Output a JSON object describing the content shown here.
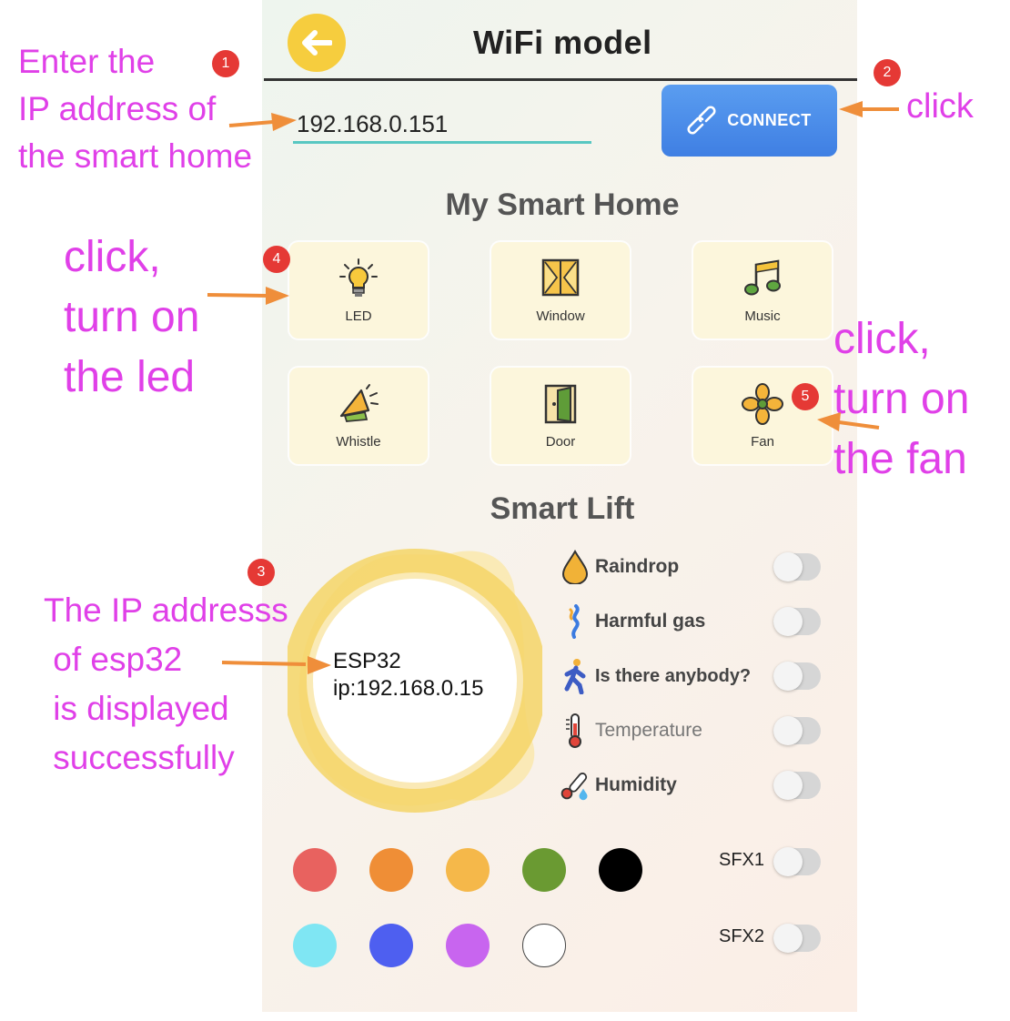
{
  "header": {
    "title": "WiFi model",
    "back_icon": "arrow-left-icon"
  },
  "connection": {
    "ip_value": "192.168.0.151",
    "connect_label": "CONNECT",
    "connect_icon": "link-icon"
  },
  "smart_home": {
    "title": "My Smart Home",
    "tiles": [
      {
        "label": "LED",
        "icon": "bulb-icon"
      },
      {
        "label": "Window",
        "icon": "window-icon"
      },
      {
        "label": "Music",
        "icon": "music-note-icon"
      },
      {
        "label": "Whistle",
        "icon": "whistle-icon"
      },
      {
        "label": "Door",
        "icon": "door-icon"
      },
      {
        "label": "Fan",
        "icon": "fan-icon"
      }
    ]
  },
  "smart_lift": {
    "title": "Smart Lift",
    "device_name": "ESP32",
    "device_ip": "ip:192.168.0.15",
    "sensors": [
      {
        "label": "Raindrop",
        "icon": "raindrop-icon",
        "on": false
      },
      {
        "label": "Harmful gas",
        "icon": "gas-icon",
        "on": false
      },
      {
        "label": "Is there anybody?",
        "icon": "person-walking-icon",
        "on": false
      },
      {
        "label": "Temperature",
        "icon": "thermometer-icon",
        "on": false
      },
      {
        "label": "Humidity",
        "icon": "humidity-icon",
        "on": false
      }
    ]
  },
  "colors": {
    "row1": [
      "#e8625f",
      "#ef8e36",
      "#f5b84a",
      "#6a9a32",
      "#000000"
    ],
    "row2": [
      "#7fe6f3",
      "#4e5ff0",
      "#c865ef",
      "#ffffff"
    ]
  },
  "sfx": {
    "sfx1_label": "SFX1",
    "sfx2_label": "SFX2"
  },
  "annotations": {
    "step1": {
      "badge": "1",
      "text": "Enter the\nIP address of\nthe smart home"
    },
    "step2": {
      "badge": "2",
      "text": "click"
    },
    "step3": {
      "badge": "3",
      "text": "The IP addresss\n of esp32\n is displayed\n successfully"
    },
    "step4": {
      "badge": "4",
      "text": "click,\nturn on\nthe led"
    },
    "step5": {
      "badge": "5",
      "text": "click,\nturn on\nthe fan"
    }
  },
  "theme": {
    "accent_yellow": "#f6cd3e",
    "connect_blue": "#4a8ce8",
    "annotation_magenta": "#e040e8",
    "badge_red": "#e53935"
  }
}
